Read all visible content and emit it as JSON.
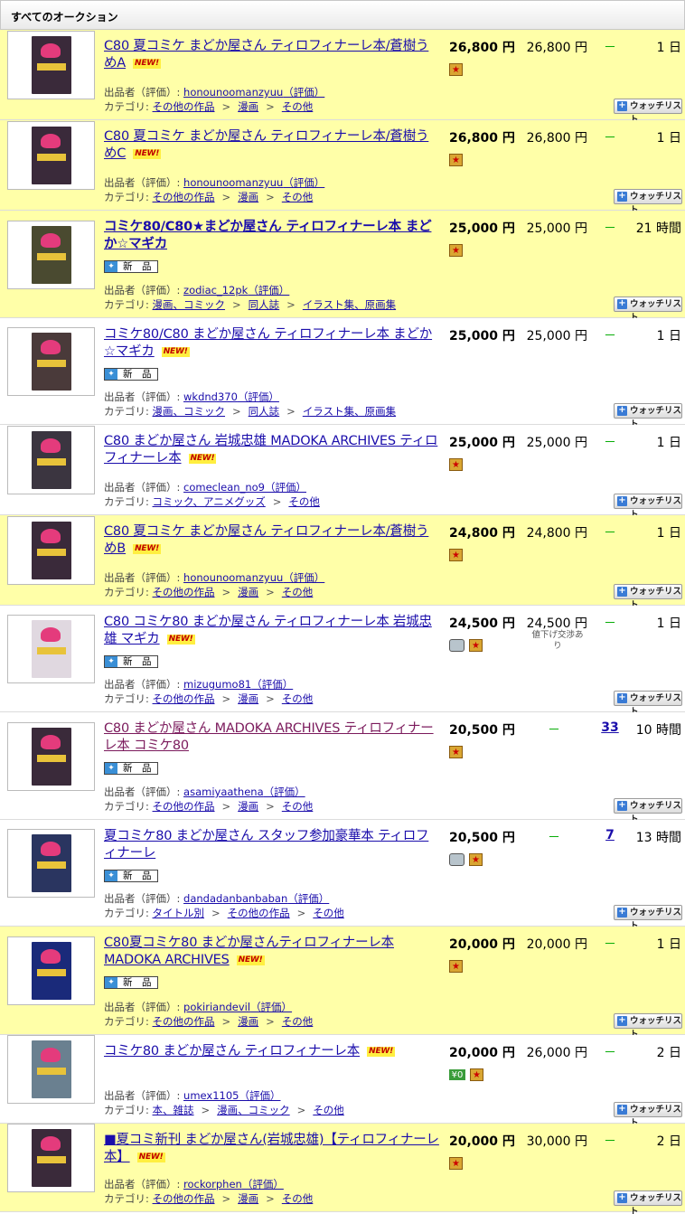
{
  "header": {
    "title": "すべてのオークション"
  },
  "labels": {
    "seller_prefix": "出品者（評価）: ",
    "rating_link": "（評価）",
    "category_prefix": "カテゴリ: ",
    "sep": ">",
    "watch": "ウォッチリスト",
    "new_item_badge": "新　品",
    "new_flag": "NEW!",
    "gift_icon": "gift-icon",
    "box_icon": "box-icon",
    "free_shipping_icon": "free-shipping-icon"
  },
  "colors": {
    "highlight_row": "#ffffa8",
    "link": "#1a0dab",
    "dash": "#00aa00"
  },
  "listings": [
    {
      "title": "C80 夏コミケ まどか屋さん ティロフィナーレ本/蒼樹うめA",
      "new": true,
      "bold": false,
      "visited": false,
      "badge": false,
      "seller": "honounoomanzyuu",
      "categories": [
        "その他の作品",
        "漫画",
        "その他"
      ],
      "price": "26,800 円",
      "buyout": "26,800 円",
      "note": "",
      "bids": "－",
      "bids_link": false,
      "time": "1 日",
      "icons": [
        "gift"
      ],
      "highlight": true,
      "cover": "#3a2a3a"
    },
    {
      "title": "C80 夏コミケ まどか屋さん ティロフィナーレ本/蒼樹うめC",
      "new": true,
      "bold": false,
      "visited": false,
      "badge": false,
      "seller": "honounoomanzyuu",
      "categories": [
        "その他の作品",
        "漫画",
        "その他"
      ],
      "price": "26,800 円",
      "buyout": "26,800 円",
      "note": "",
      "bids": "－",
      "bids_link": false,
      "time": "1 日",
      "icons": [
        "gift"
      ],
      "highlight": true,
      "cover": "#3a2a3a"
    },
    {
      "title": "コミケ80/C80★まどか屋さん ティロフィナーレ本 まどか☆マギカ",
      "new": false,
      "bold": true,
      "visited": false,
      "badge": true,
      "seller": "zodiac_12pk",
      "categories": [
        "漫画、コミック",
        "同人誌",
        "イラスト集、原画集"
      ],
      "price": "25,000 円",
      "buyout": "25,000 円",
      "note": "",
      "bids": "－",
      "bids_link": false,
      "time": "21 時間",
      "icons": [
        "gift"
      ],
      "highlight": true,
      "cover": "#4a4a30"
    },
    {
      "title": "コミケ80/C80 まどか屋さん ティロフィナーレ本 まどか☆マギカ",
      "new": true,
      "bold": false,
      "visited": false,
      "badge": true,
      "seller": "wkdnd370",
      "categories": [
        "漫画、コミック",
        "同人誌",
        "イラスト集、原画集"
      ],
      "price": "25,000 円",
      "buyout": "25,000 円",
      "note": "",
      "bids": "－",
      "bids_link": false,
      "time": "1 日",
      "icons": [],
      "highlight": false,
      "cover": "#4a3a3a"
    },
    {
      "title": "C80 まどか屋さん 岩城忠雄 MADOKA ARCHIVES ティロフィナーレ本",
      "new": true,
      "bold": false,
      "visited": false,
      "badge": false,
      "seller": "comeclean_no9",
      "categories": [
        "コミック、アニメグッズ",
        "その他"
      ],
      "price": "25,000 円",
      "buyout": "25,000 円",
      "note": "",
      "bids": "－",
      "bids_link": false,
      "time": "1 日",
      "icons": [
        "gift"
      ],
      "highlight": false,
      "cover": "#3b3540"
    },
    {
      "title": "C80 夏コミケ まどか屋さん ティロフィナーレ本/蒼樹うめB",
      "new": true,
      "bold": false,
      "visited": false,
      "badge": false,
      "seller": "honounoomanzyuu",
      "categories": [
        "その他の作品",
        "漫画",
        "その他"
      ],
      "price": "24,800 円",
      "buyout": "24,800 円",
      "note": "",
      "bids": "－",
      "bids_link": false,
      "time": "1 日",
      "icons": [
        "gift"
      ],
      "highlight": true,
      "cover": "#3a2a3a"
    },
    {
      "title": "C80 コミケ80 まどか屋さん ティロフィナーレ本 岩城忠雄 マギカ",
      "new": true,
      "bold": false,
      "visited": false,
      "badge": true,
      "seller": "mizugumo81",
      "categories": [
        "その他の作品",
        "漫画",
        "その他"
      ],
      "price": "24,500 円",
      "buyout": "24,500 円",
      "note": "値下げ交渉あり",
      "bids": "－",
      "bids_link": false,
      "time": "1 日",
      "icons": [
        "box",
        "gift"
      ],
      "highlight": false,
      "cover": "#e0d8e0"
    },
    {
      "title": "C80 まどか屋さん MADOKA ARCHIVES ティロフィナーレ本 コミケ80",
      "new": false,
      "bold": false,
      "visited": true,
      "badge": true,
      "seller": "asamiyaathena",
      "categories": [
        "その他の作品",
        "漫画",
        "その他"
      ],
      "price": "20,500 円",
      "buyout": "－",
      "note": "",
      "bids": "33",
      "bids_link": true,
      "time": "10 時間",
      "icons": [
        "gift"
      ],
      "highlight": false,
      "cover": "#3a2a3a"
    },
    {
      "title": "夏コミケ80 まどか屋さん スタッフ参加豪華本 ティロフィナーレ",
      "new": false,
      "bold": false,
      "visited": false,
      "badge": true,
      "seller": "dandadanbanbaban",
      "categories": [
        "タイトル別",
        "その他の作品",
        "その他"
      ],
      "price": "20,500 円",
      "buyout": "－",
      "note": "",
      "bids": "7",
      "bids_link": true,
      "time": "13 時間",
      "icons": [
        "box",
        "gift"
      ],
      "highlight": false,
      "cover": "#2a3560"
    },
    {
      "title": "C80夏コミケ80 まどか屋さんティロフィナーレ本 MADOKA ARCHIVES",
      "new": true,
      "bold": false,
      "visited": false,
      "badge": true,
      "seller": "pokiriandevil",
      "categories": [
        "その他の作品",
        "漫画",
        "その他"
      ],
      "price": "20,000 円",
      "buyout": "20,000 円",
      "note": "",
      "bids": "－",
      "bids_link": false,
      "time": "1 日",
      "icons": [
        "gift"
      ],
      "highlight": true,
      "cover": "#1a2a7a"
    },
    {
      "title": "コミケ80 まどか屋さん ティロフィナーレ本",
      "new": true,
      "bold": false,
      "visited": false,
      "badge": false,
      "seller": "umex1105",
      "categories": [
        "本、雑誌",
        "漫画、コミック",
        "その他"
      ],
      "price": "20,000 円",
      "buyout": "26,000 円",
      "note": "",
      "bids": "－",
      "bids_link": false,
      "time": "2 日",
      "icons": [
        "ship",
        "gift"
      ],
      "highlight": false,
      "cover": "#6a8090"
    },
    {
      "title": "■夏コミ新刊 まどか屋さん(岩城忠雄)【ティロフィナーレ本】",
      "new": true,
      "bold": false,
      "visited": false,
      "badge": false,
      "seller": "rockorphen",
      "categories": [
        "その他の作品",
        "漫画",
        "その他"
      ],
      "price": "20,000 円",
      "buyout": "30,000 円",
      "note": "",
      "bids": "－",
      "bids_link": false,
      "time": "2 日",
      "icons": [
        "gift"
      ],
      "highlight": true,
      "cover": "#3a2a3a"
    }
  ]
}
